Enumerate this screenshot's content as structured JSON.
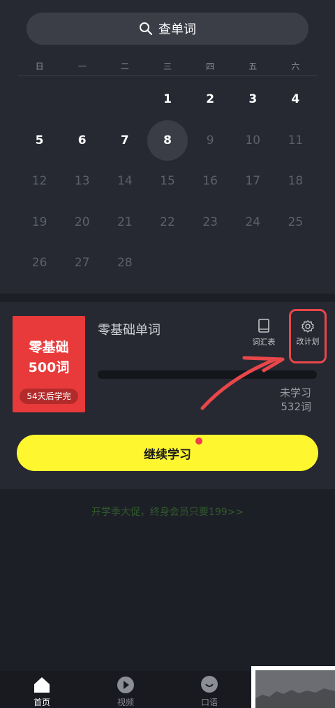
{
  "search": {
    "label": "查单词"
  },
  "weekdays": [
    "日",
    "一",
    "二",
    "三",
    "四",
    "五",
    "六"
  ],
  "calendar": {
    "today": 8
  },
  "course": {
    "title": "零基础单词",
    "book_line1": "零基础",
    "book_line2": "500词",
    "book_badge": "54天后学完",
    "vocab_label": "词汇表",
    "plan_label": "改计划",
    "unlearned_label": "未学习",
    "unlearned_count": "532词",
    "continue_label": "继续学习"
  },
  "promo": {
    "text": "开学季大促，终身会员只要199>>"
  },
  "tabs": [
    {
      "label": "首页"
    },
    {
      "label": "视频"
    },
    {
      "label": "口语"
    }
  ],
  "colors": {
    "accent_yellow": "#fef72f",
    "book_red": "#e83a3a",
    "annotation_red": "#e8474a"
  }
}
